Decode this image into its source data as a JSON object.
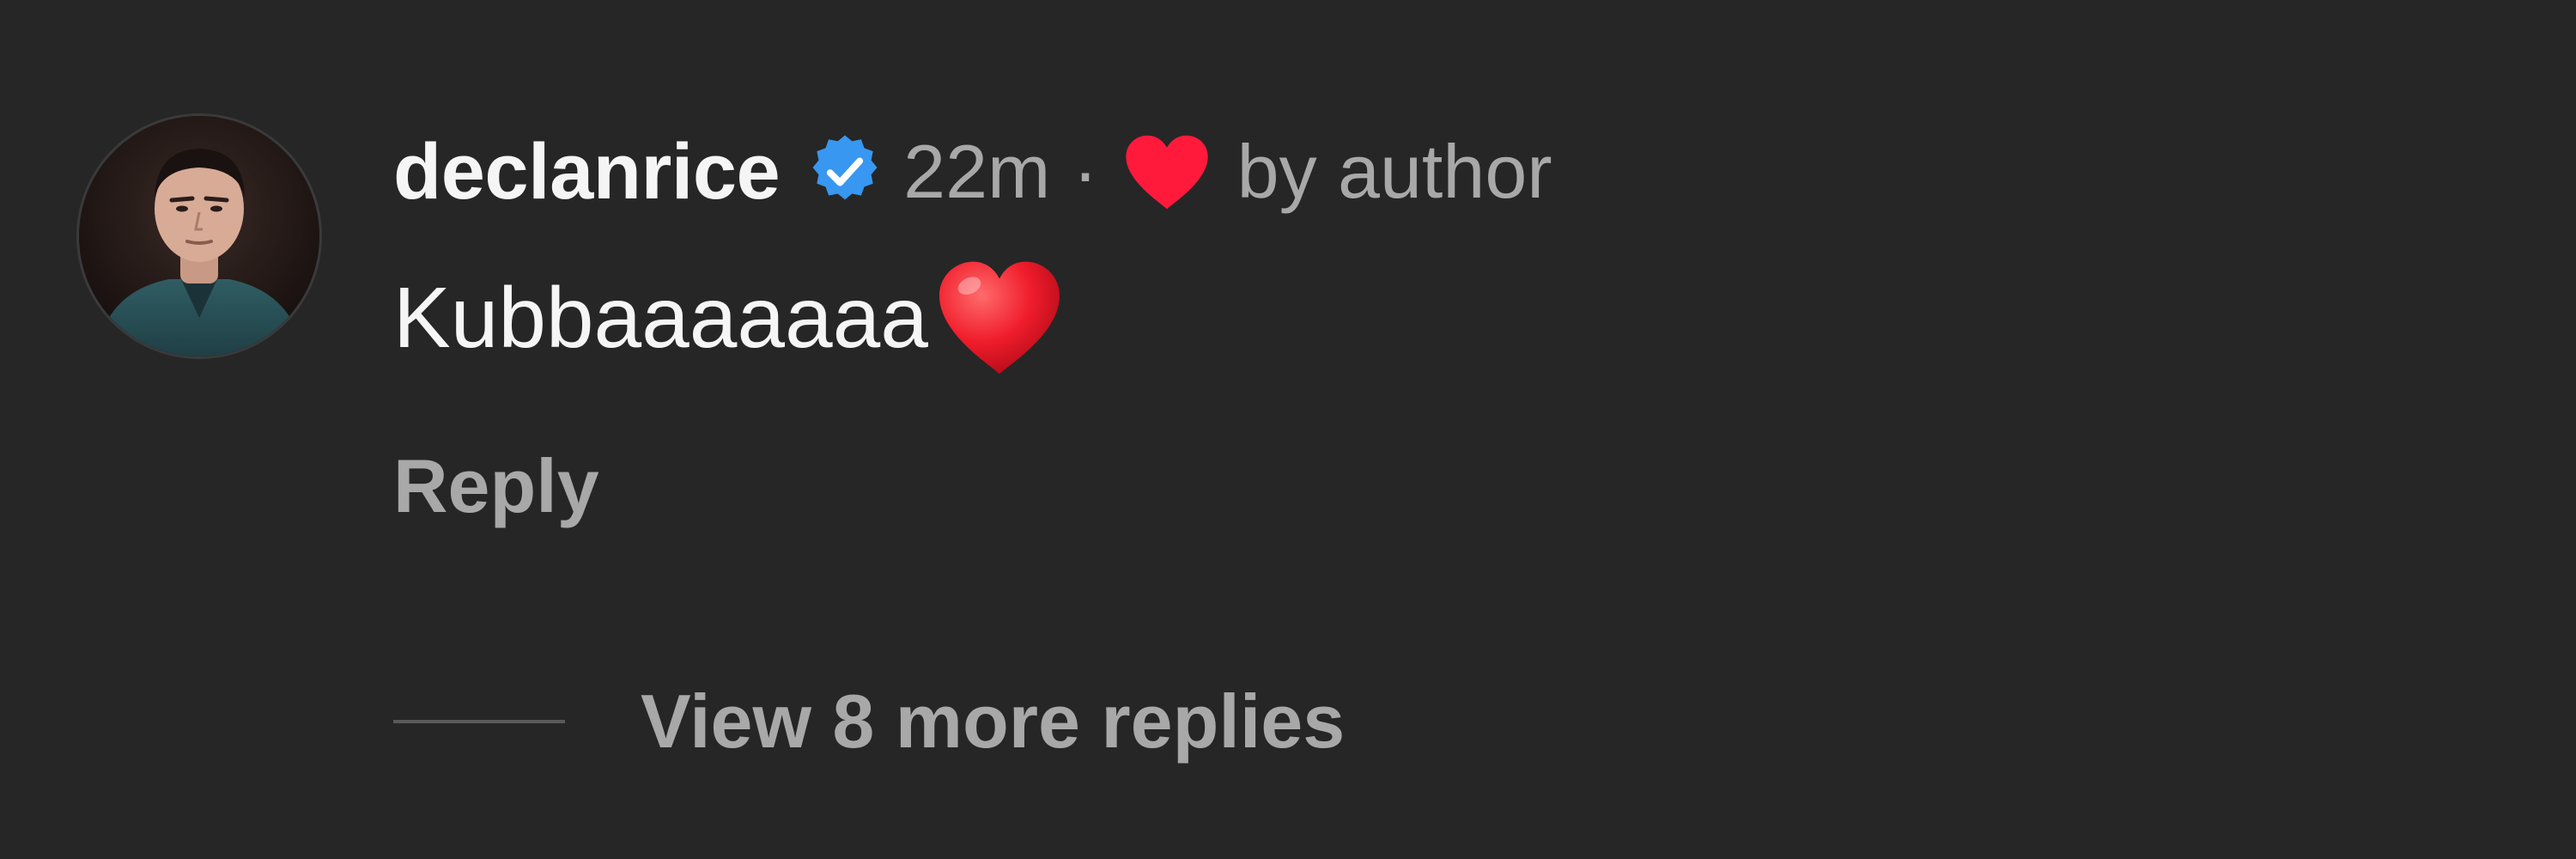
{
  "comment": {
    "username": "declanrice",
    "verified_icon": "verified-badge-icon",
    "timestamp": "22m",
    "separator": "·",
    "liked_icon": "heart-icon",
    "liked_by": "by author",
    "text": "Kubbaaaaaaa",
    "emoji_icon": "red-heart-emoji",
    "reply_label": "Reply",
    "view_replies_label": "View 8 more replies"
  },
  "colors": {
    "background": "#262626",
    "primary_text": "#f5f5f5",
    "secondary_text": "#a8a8a8",
    "verified_blue": "#3897f0",
    "heart_red": "#ff1a3c"
  }
}
